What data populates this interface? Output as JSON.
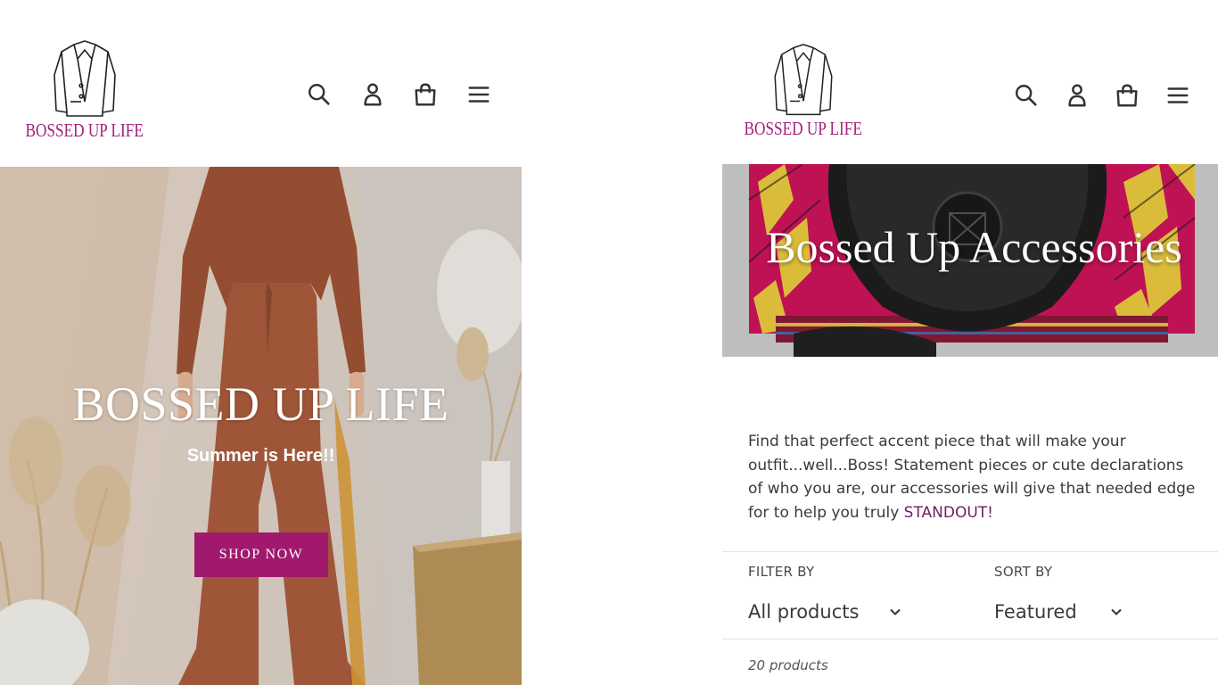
{
  "left": {
    "brand": "BOSSED UP LIFE",
    "hero": {
      "title": "BOSSED UP LIFE",
      "subtitle": "Summer is Here!!",
      "button": "SHOP NOW"
    }
  },
  "right": {
    "brand": "BOSSED UP LIFE",
    "collection": {
      "title": "Bossed Up Accessories",
      "description_main": "Find that perfect accent piece that will make your outfit...well...Boss! Statement pieces or cute declarations of who you are, our accessories will give that needed edge for to help you truly ",
      "description_highlight": "STANDOUT!"
    },
    "filter": {
      "label": "FILTER BY",
      "value": "All products"
    },
    "sort": {
      "label": "SORT BY",
      "value": "Featured"
    },
    "product_count": "20 products"
  },
  "icons": [
    "search-icon",
    "account-icon",
    "cart-icon",
    "menu-icon"
  ],
  "colors": {
    "brand": "#a0217a",
    "button": "#a0196d",
    "highlight": "#6e1e63"
  }
}
